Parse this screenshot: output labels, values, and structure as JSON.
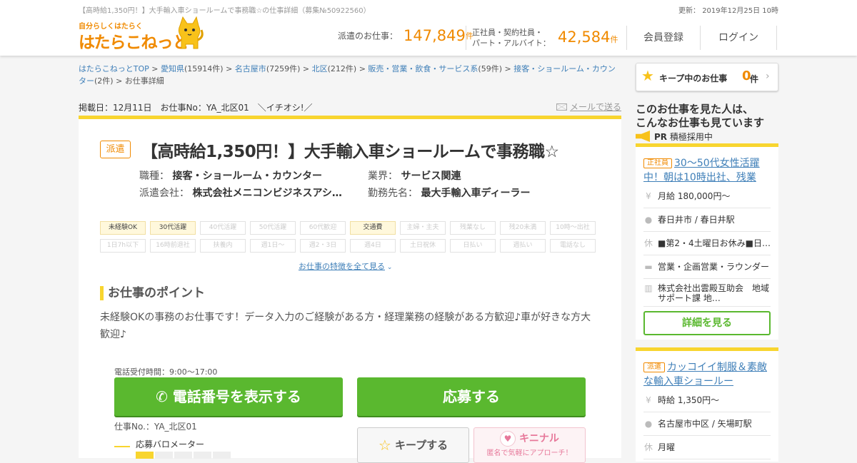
{
  "header": {
    "page_title": "【高時給1,350円！】大手輸入車ショールームで事務職☆の仕事詳細（募集№50922560）",
    "updated": "更新： 2019年12月25日 10時",
    "logo_tagline": "自分らしくはたらく",
    "logo_name": "はたらこねっと",
    "stats": {
      "haken_label": "派遣のお仕事：",
      "haken_count": "147,849",
      "unit": "件",
      "other_label_1": "正社員・契約社員・",
      "other_label_2": "パート・アルバイト：",
      "other_count": "42,584"
    },
    "nav": {
      "register": "会員登録",
      "login": "ログイン"
    }
  },
  "breadcrumb": {
    "items": [
      {
        "label": "はたらこねっとTOP",
        "count": ""
      },
      {
        "label": "愛知県",
        "count": "(15914件)"
      },
      {
        "label": "名古屋市",
        "count": "(7259件)"
      },
      {
        "label": "北区",
        "count": "(212件)"
      },
      {
        "label": "販売・営業・飲食・サービス系",
        "count": "(59件)"
      },
      {
        "label": "接客・ショールーム・カウンター",
        "count": "(2件)"
      }
    ],
    "current": "お仕事詳細",
    "sep": " > "
  },
  "posting": {
    "posted": "掲載日：12月11日　お仕事No：YA_北区01　＼イチオシ!／",
    "mail_link": "メールで送る"
  },
  "job": {
    "type_badge": "派遣",
    "title": "【高時給1,350円！】大手輸入車ショールームで事務職☆",
    "fields": {
      "job_type_label": "職種：",
      "job_type": "接客・ショールーム・カウンター",
      "industry_label": "業界：",
      "industry": "サービス関連",
      "agency_label": "派遣会社：",
      "agency": "株式会社メニコンビジネスアシ…",
      "workplace_label": "勤務先名：",
      "workplace": "最大手輸入車ディーラー"
    },
    "tags": [
      {
        "label": "未経験OK",
        "on": true
      },
      {
        "label": "30代活躍",
        "on": true
      },
      {
        "label": "40代活躍",
        "on": false
      },
      {
        "label": "50代活躍",
        "on": false
      },
      {
        "label": "60代歓迎",
        "on": false
      },
      {
        "label": "交通費",
        "on": true
      },
      {
        "label": "主婦・主夫",
        "on": false
      },
      {
        "label": "残業なし",
        "on": false
      },
      {
        "label": "残20未満",
        "on": false
      },
      {
        "label": "10時～出社",
        "on": false
      },
      {
        "label": "1日7h以下",
        "on": false
      },
      {
        "label": "16時前退社",
        "on": false
      },
      {
        "label": "扶養内",
        "on": false
      },
      {
        "label": "週1日～",
        "on": false
      },
      {
        "label": "週2・3日",
        "on": false
      },
      {
        "label": "週4日",
        "on": false
      },
      {
        "label": "土日祝休",
        "on": false
      },
      {
        "label": "日払い",
        "on": false
      },
      {
        "label": "週払い",
        "on": false
      },
      {
        "label": "電話なし",
        "on": false
      }
    ],
    "more_features": "お仕事の特徴を全て見る",
    "point_heading": "お仕事のポイント",
    "point_text": "未経験OKの事務のお仕事です！データ入力のご経験がある方・経理業務の経験がある方歓迎♪車が好きな方大歓迎♪",
    "tel_time": "電話受付時間：9:00～17:00",
    "show_phone": "電話番号を表示する",
    "apply": "応募する",
    "job_no": "仕事No.：YA_北区01",
    "meter_label": "応募バロメーター",
    "keep": "キープする",
    "kinenal_name": "キニナル",
    "kinenal_sub": "匿名で気軽にアプローチ！"
  },
  "sidebar": {
    "keep_label": "キープ中のお仕事",
    "keep_count": "0",
    "keep_unit": "件",
    "heading_1": "このお仕事を見た人は、",
    "heading_2": "こんなお仕事も見ています",
    "pr_label": "PR",
    "pr_text": "積極採用中",
    "recs": [
      {
        "badge": "正社員",
        "title": "30～50代女性活躍中！朝は10時出社、残業",
        "salary": "月給 180,000円～",
        "location": "春日井市 / 春日井駅",
        "holiday": "■第2・4土曜日お休み■日…",
        "job": "営業・企画営業・ラウンダー",
        "company": "株式会社出雲殿互助会　地域サポート課 地…",
        "detail_button": "詳細を見る"
      },
      {
        "badge": "派遣",
        "title": "カッコイイ制服＆素敵な輸入車ショールー",
        "salary": "時給 1,350円～",
        "location": "名古屋市中区 / 矢場町駅",
        "holiday": "月曜"
      }
    ]
  },
  "colors": {
    "accent": "#f08a00",
    "yellow": "#f8d52f",
    "green": "#5ab82f",
    "link": "#3f7fb8"
  }
}
